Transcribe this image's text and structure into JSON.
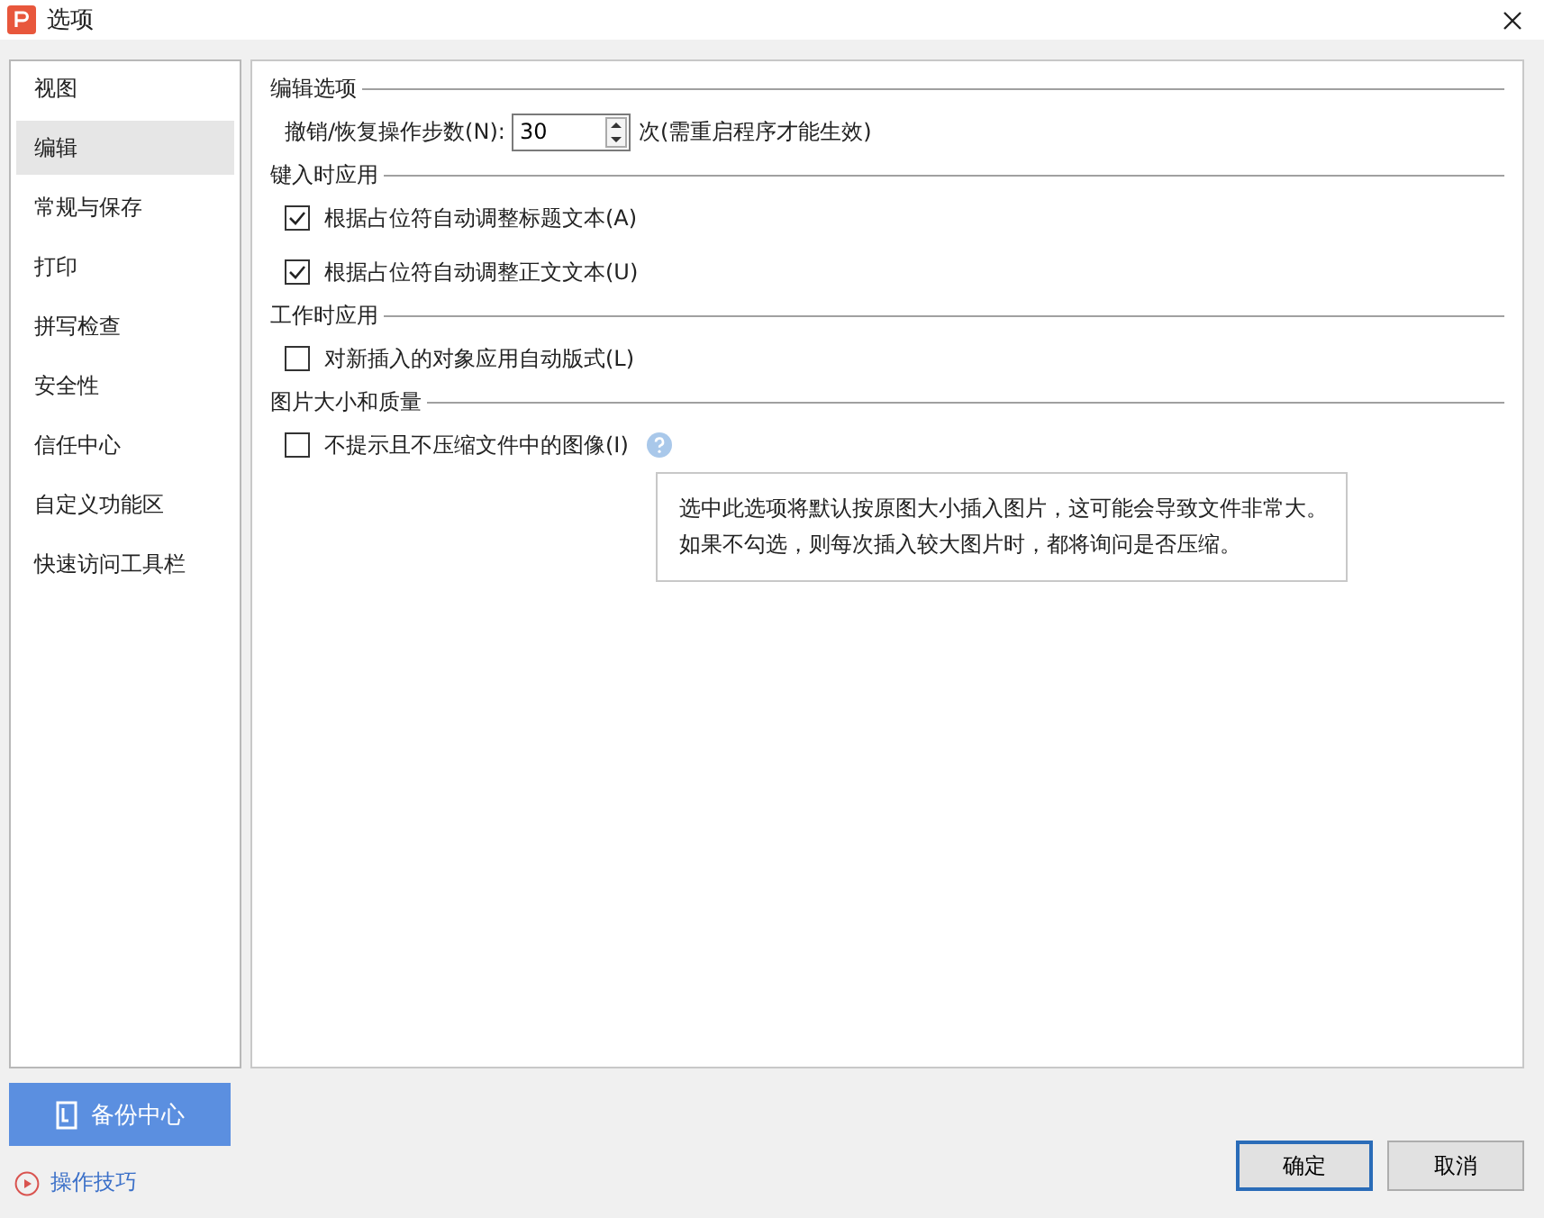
{
  "window": {
    "title": "选项"
  },
  "sidebar": {
    "items": [
      {
        "label": "视图",
        "selected": false
      },
      {
        "label": "编辑",
        "selected": true
      },
      {
        "label": "常规与保存",
        "selected": false
      },
      {
        "label": "打印",
        "selected": false
      },
      {
        "label": "拼写检查",
        "selected": false
      },
      {
        "label": "安全性",
        "selected": false
      },
      {
        "label": "信任中心",
        "selected": false
      },
      {
        "label": "自定义功能区",
        "selected": false
      },
      {
        "label": "快速访问工具栏",
        "selected": false
      }
    ]
  },
  "sections": [
    {
      "title": "编辑选项",
      "rows": [
        {
          "kind": "spinner",
          "label": "撤销/恢复操作步数(N):",
          "value": "30",
          "suffix": "次(需重启程序才能生效)"
        }
      ]
    },
    {
      "title": "键入时应用",
      "rows": [
        {
          "kind": "checkbox",
          "label": "根据占位符自动调整标题文本(A)",
          "checked": true
        },
        {
          "kind": "checkbox",
          "label": "根据占位符自动调整正文文本(U)",
          "checked": true
        }
      ]
    },
    {
      "title": "工作时应用",
      "rows": [
        {
          "kind": "checkbox",
          "label": "对新插入的对象应用自动版式(L)",
          "checked": false
        }
      ]
    },
    {
      "title": "图片大小和质量",
      "rows": [
        {
          "kind": "checkbox",
          "label": "不提示且不压缩文件中的图像(I)",
          "checked": false,
          "help": true
        }
      ]
    }
  ],
  "tooltip": {
    "lines": [
      "选中此选项将默认按原图大小插入图片，这可能会导致文件非常大。",
      "如果不勾选，则每次插入较大图片时，都将询问是否压缩。"
    ]
  },
  "backup_button": "备份中心",
  "tips_link": "操作技巧",
  "buttons": [
    {
      "label": "确定",
      "selected": true
    },
    {
      "label": "取消",
      "selected": false
    }
  ]
}
